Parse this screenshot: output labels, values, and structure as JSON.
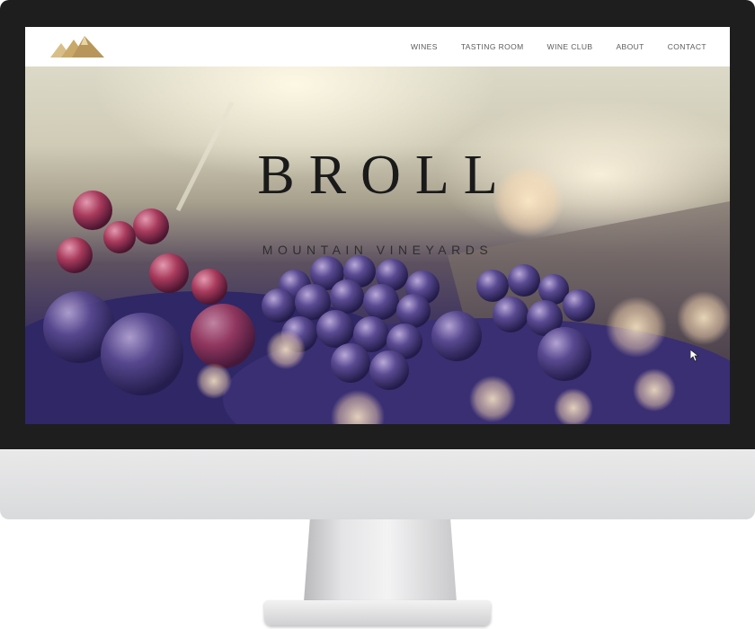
{
  "site": {
    "nav": [
      {
        "label": "WINES"
      },
      {
        "label": "TASTING ROOM"
      },
      {
        "label": "WINE CLUB"
      },
      {
        "label": "ABOUT"
      },
      {
        "label": "CONTACT"
      }
    ],
    "logo_icon": "mountain-logo-icon"
  },
  "hero": {
    "title": "BROLL",
    "subtitle": "MOUNTAIN VINEYARDS",
    "image": "grapes-photo"
  },
  "colors": {
    "logo_gold": "#c9a96a",
    "nav_text": "#5b5b5b",
    "title_text": "#1a1a1a",
    "bezel": "#1e1e1e",
    "chin": "#e4e4e5"
  }
}
